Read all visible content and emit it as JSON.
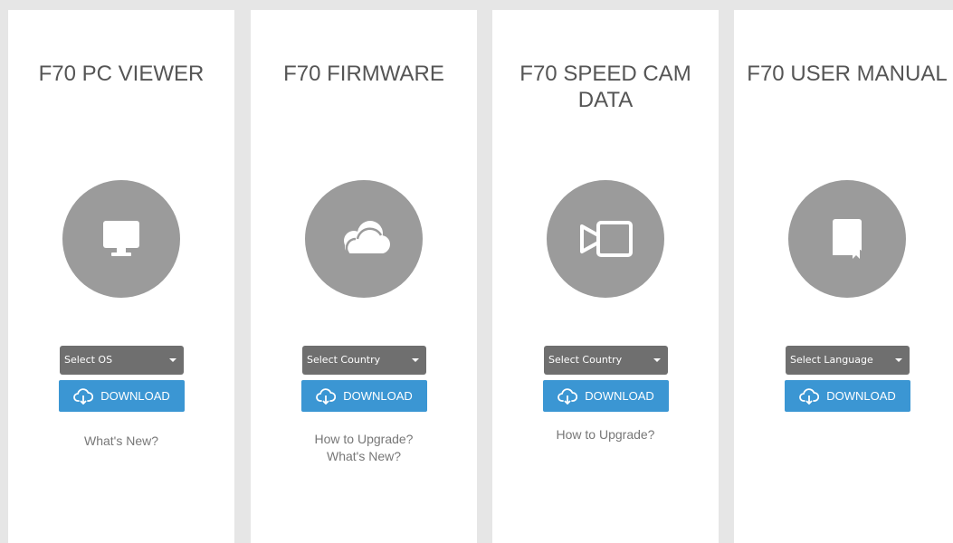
{
  "cards": [
    {
      "title": "F70 PC VIEWER",
      "icon": "monitor-icon",
      "select_label": "Select OS",
      "download_label": "DOWNLOAD",
      "links": [
        "What's New?"
      ]
    },
    {
      "title": "F70 FIRMWARE",
      "icon": "cloud-icon",
      "select_label": "Select Country",
      "download_label": "DOWNLOAD",
      "links": [
        "How to Upgrade?",
        "What's New?"
      ]
    },
    {
      "title": "F70 SPEED CAM\nDATA",
      "icon": "video-camera-icon",
      "select_label": "Select Country",
      "download_label": "DOWNLOAD",
      "links": [
        "How to Upgrade?"
      ]
    },
    {
      "title": "F70 USER MANUAL",
      "icon": "book-icon",
      "select_label": "Select Language",
      "download_label": "DOWNLOAD",
      "links": []
    }
  ],
  "colors": {
    "background": "#e6e6e6",
    "card": "#ffffff",
    "icon_circle": "#9b9b9b",
    "select": "#6f6f6f",
    "download_button": "#3b96d3",
    "title_text": "#555555",
    "link_text": "#777777"
  }
}
